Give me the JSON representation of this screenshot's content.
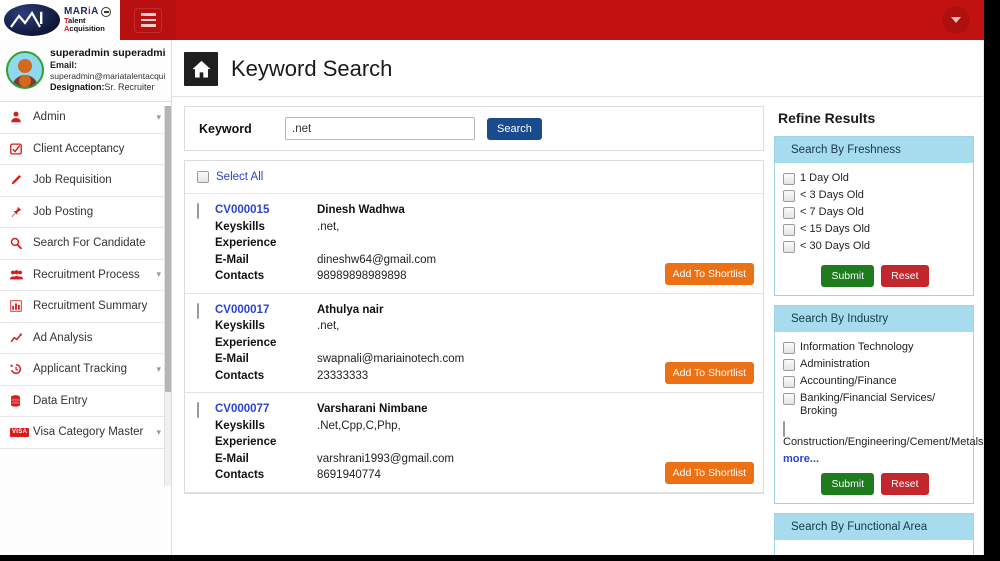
{
  "topbar": {
    "logo": {
      "line1_pre": "MAR",
      "line1_i": "i",
      "line1_post": "A",
      "line2": "Talent Acquisition",
      "badge_icon": "minus-circle-icon"
    },
    "menu_toggle_icon": "hamburger-icon",
    "user_menu_icon": "caret-down-icon"
  },
  "sidebar": {
    "profile": {
      "name": "superadmin superadmin",
      "email_label": "Email:",
      "email": "superadmin@mariatalentacqui",
      "designation_label": "Designation:",
      "designation": "Sr. Recruiter"
    },
    "items": [
      {
        "label": "Admin",
        "icon": "user-icon",
        "chevron": true
      },
      {
        "label": "Client Acceptancy",
        "icon": "check-square-icon",
        "chevron": false
      },
      {
        "label": "Job Requisition",
        "icon": "pencil-icon",
        "chevron": false
      },
      {
        "label": "Job Posting",
        "icon": "pin-icon",
        "chevron": false
      },
      {
        "label": "Search For Candidate",
        "icon": "search-icon",
        "chevron": false
      },
      {
        "label": "Recruitment Process",
        "icon": "users-icon",
        "chevron": true
      },
      {
        "label": "Recruitment Summary",
        "icon": "bar-chart-icon",
        "chevron": false
      },
      {
        "label": "Ad Analysis",
        "icon": "line-chart-icon",
        "chevron": false
      },
      {
        "label": "Applicant Tracking",
        "icon": "history-icon",
        "chevron": true
      },
      {
        "label": "Data Entry",
        "icon": "database-icon",
        "chevron": false
      },
      {
        "label": "Visa Category Master",
        "icon": "visa-badge-icon",
        "chevron": true
      }
    ]
  },
  "page": {
    "home_icon": "home-icon",
    "title": "Keyword Search"
  },
  "search": {
    "keyword_label": "Keyword",
    "keyword_value": ".net",
    "keyword_placeholder": "",
    "search_button": "Search"
  },
  "results": {
    "select_all_label": "Select All",
    "field_labels": {
      "keyskills": "Keyskills",
      "experience": "Experience",
      "email": "E-Mail",
      "contacts": "Contacts"
    },
    "shortlist_button": "Add To Shortlist",
    "candidates": [
      {
        "id": "CV000015",
        "name": "Dinesh  Wadhwa",
        "keyskills": ".net,",
        "experience": "",
        "email": "dineshw64@gmail.com",
        "contacts": "98989898989898"
      },
      {
        "id": "CV000017",
        "name": "Athulya  nair",
        "keyskills": ".net,",
        "experience": "",
        "email": "swapnali@mariainotech.com",
        "contacts": "23333333"
      },
      {
        "id": "CV000077",
        "name": "Varsharani  Nimbane",
        "keyskills": ".Net,Cpp,C,Php,",
        "experience": "",
        "email": "varshrani1993@gmail.com",
        "contacts": "8691940774"
      }
    ]
  },
  "refine": {
    "title": "Refine Results",
    "submit_label": "Submit",
    "reset_label": "Reset",
    "more_label": "more...",
    "facets": [
      {
        "title": "Search By Freshness",
        "options": [
          "1 Day Old",
          "< 3 Days Old",
          "< 7 Days Old",
          "< 15 Days Old",
          "< 30 Days Old"
        ],
        "has_more": false
      },
      {
        "title": "Search By Industry",
        "options": [
          "Information Technology",
          "Administration",
          "Accounting/Finance",
          "Banking/Financial Services/ Broking",
          "Construction/Engineering/Cement/Metals"
        ],
        "has_more": true
      },
      {
        "title": "Search By Functional Area",
        "options": [],
        "has_more": false
      }
    ]
  },
  "colors": {
    "brand_red": "#c21111",
    "accent_blue": "#1b4b8f",
    "shortlist_orange": "#ec7014",
    "facet_header": "#a7dcef",
    "submit_green": "#1e7b1e",
    "reset_red": "#c1272d",
    "link_blue": "#2a43d0"
  }
}
